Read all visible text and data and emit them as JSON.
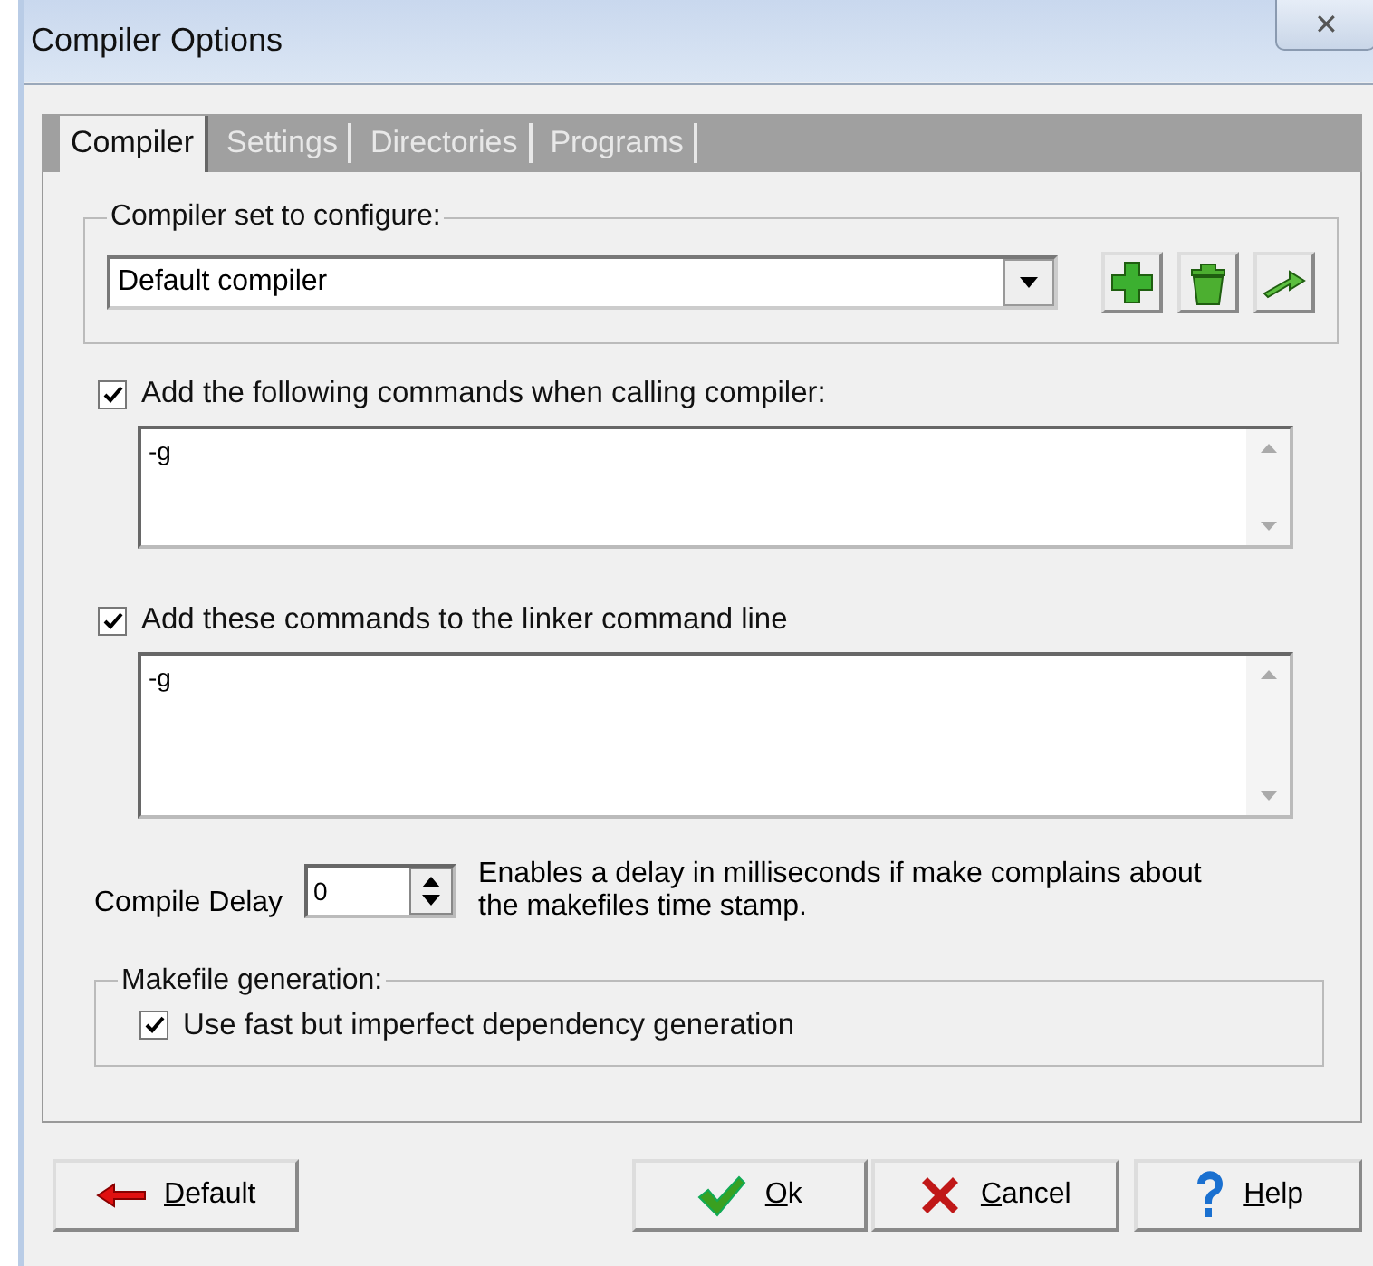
{
  "window": {
    "title": "Compiler Options",
    "close": "✕"
  },
  "tabs": [
    {
      "label": "Compiler",
      "selected": true
    },
    {
      "label": "Settings",
      "selected": false
    },
    {
      "label": "Directories",
      "selected": false
    },
    {
      "label": "Programs",
      "selected": false
    }
  ],
  "compiler_set": {
    "legend": "Compiler set to configure:",
    "value": "Default compiler"
  },
  "compiler_commands": {
    "label": "Add the following commands when calling compiler:",
    "checked": true,
    "value": "-g"
  },
  "linker_commands": {
    "label": "Add these commands to the linker command line",
    "checked": true,
    "value": "-g"
  },
  "compile_delay": {
    "label": "Compile Delay",
    "value": "0",
    "hint": "Enables a delay in milliseconds if make complains about the makefiles time stamp."
  },
  "makefile": {
    "legend": "Makefile generation:",
    "option": {
      "label": "Use fast but imperfect dependency generation",
      "checked": true
    }
  },
  "buttons": [
    {
      "kind": "default",
      "label": "Default"
    },
    {
      "kind": "ok",
      "label": "Ok"
    },
    {
      "kind": "cancel",
      "label": "Cancel"
    },
    {
      "kind": "help",
      "label": "Help"
    }
  ]
}
